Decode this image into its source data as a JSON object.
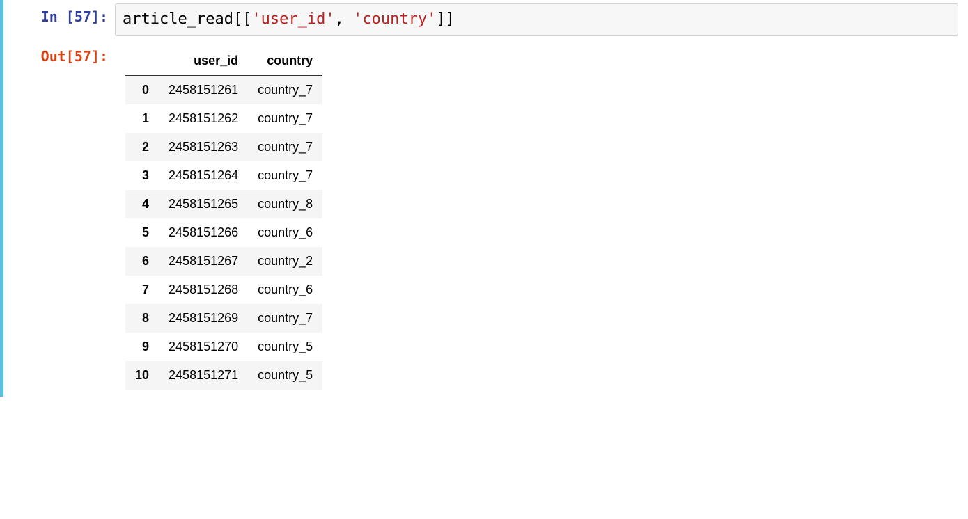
{
  "prompt": {
    "in_label": "In [57]:",
    "out_label": "Out[57]:"
  },
  "code": {
    "part1": "article_read[[",
    "str1": "'user_id'",
    "sep": ", ",
    "str2": "'country'",
    "part2": "]]"
  },
  "df": {
    "columns": [
      "user_id",
      "country"
    ],
    "index": [
      "0",
      "1",
      "2",
      "3",
      "4",
      "5",
      "6",
      "7",
      "8",
      "9",
      "10"
    ],
    "rows": [
      {
        "user_id": "2458151261",
        "country": "country_7"
      },
      {
        "user_id": "2458151262",
        "country": "country_7"
      },
      {
        "user_id": "2458151263",
        "country": "country_7"
      },
      {
        "user_id": "2458151264",
        "country": "country_7"
      },
      {
        "user_id": "2458151265",
        "country": "country_8"
      },
      {
        "user_id": "2458151266",
        "country": "country_6"
      },
      {
        "user_id": "2458151267",
        "country": "country_2"
      },
      {
        "user_id": "2458151268",
        "country": "country_6"
      },
      {
        "user_id": "2458151269",
        "country": "country_7"
      },
      {
        "user_id": "2458151270",
        "country": "country_5"
      },
      {
        "user_id": "2458151271",
        "country": "country_5"
      }
    ]
  }
}
